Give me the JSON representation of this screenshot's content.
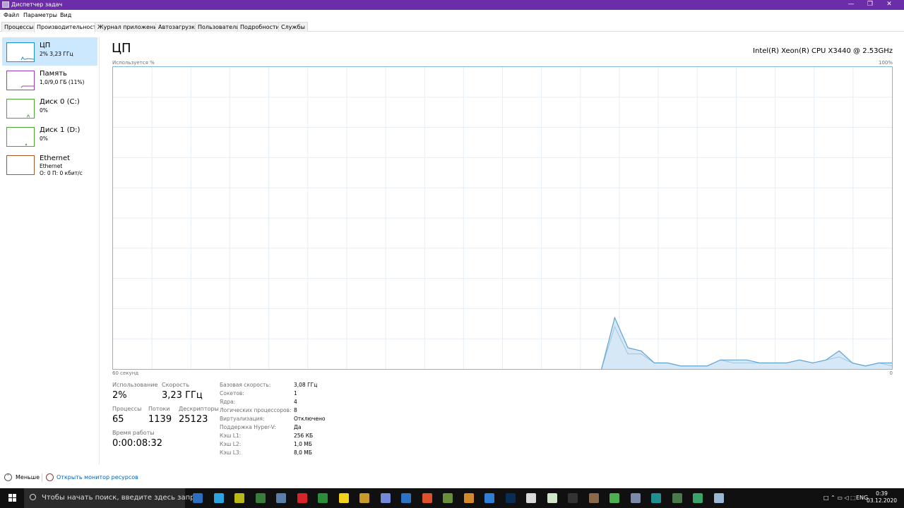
{
  "window": {
    "title": "Диспетчер задач",
    "minimize": "—",
    "maximize": "❐",
    "close": "✕"
  },
  "menu": [
    "Файл",
    "Параметры",
    "Вид"
  ],
  "tabs": [
    "Процессы",
    "Производительность",
    "Журнал приложений",
    "Автозагрузка",
    "Пользователи",
    "Подробности",
    "Службы"
  ],
  "sidebar": [
    {
      "name": "ЦП",
      "sub1": "2% 3,23 ГГц",
      "sub2": "",
      "color": "#1b8fd6"
    },
    {
      "name": "Память",
      "sub1": "1,0/9,0 ГБ (11%)",
      "sub2": "",
      "color": "#9b3ec2"
    },
    {
      "name": "Диск 0 (C:)",
      "sub1": "0%",
      "sub2": "",
      "color": "#4da632"
    },
    {
      "name": "Диск 1 (D:)",
      "sub1": "0%",
      "sub2": "",
      "color": "#4da632"
    },
    {
      "name": "Ethernet",
      "sub1": "Ethernet",
      "sub2": "О: 0 П: 0 кбит/с",
      "color": "#a7572b"
    }
  ],
  "main": {
    "title": "ЦП",
    "cpu_name": "Intel(R) Xeon(R) CPU X3440 @ 2.53GHz",
    "usage_label": "Используется %",
    "usage_max": "100%",
    "time_left": "60 секунд",
    "time_right": "0"
  },
  "stats": {
    "usage_label": "Использование",
    "usage_value": "2%",
    "speed_label": "Скорость",
    "speed_value": "3,23 ГГц",
    "processes_label": "Процессы",
    "processes_value": "65",
    "threads_label": "Потоки",
    "threads_value": "1139",
    "handles_label": "Дескрипторы",
    "handles_value": "25123",
    "uptime_label": "Время работы",
    "uptime_value": "0:00:08:32"
  },
  "details": [
    {
      "label": "Базовая скорость:",
      "value": "3,08 ГГц"
    },
    {
      "label": "Сокетов:",
      "value": "1"
    },
    {
      "label": "Ядра:",
      "value": "4"
    },
    {
      "label": "Логических процессоров:",
      "value": "8"
    },
    {
      "label": "Виртуализация:",
      "value": "Отключено"
    },
    {
      "label": "Поддержка Hyper-V:",
      "value": "Да"
    },
    {
      "label": "Кэш L1:",
      "value": "256 КБ"
    },
    {
      "label": "Кэш L2:",
      "value": "1,0 МБ"
    },
    {
      "label": "Кэш L3:",
      "value": "8,0 МБ"
    }
  ],
  "footer": {
    "fewer": "Меньше",
    "monitor": "Открыть монитор ресурсов"
  },
  "chart_data": {
    "type": "area",
    "x_range_seconds": [
      60,
      0
    ],
    "ylim": [
      0,
      100
    ],
    "samples_total": 60,
    "usage_percent": [
      17,
      7,
      6,
      2,
      2,
      1,
      1,
      1,
      3,
      3,
      3,
      2,
      2,
      2,
      3,
      2,
      3,
      6,
      2,
      1,
      2,
      2
    ],
    "kernel_percent": [
      14,
      5,
      5,
      2,
      2,
      1,
      1,
      1,
      3,
      2,
      2,
      2,
      2,
      2,
      3,
      2,
      3,
      4,
      2,
      1,
      2,
      1
    ],
    "grid": true
  },
  "taskbar": {
    "search_placeholder": "Чтобы начать поиск, введите здесь запрос",
    "lang": "ENG",
    "time": "0:39",
    "date": "03.12.2020",
    "icons": [
      {
        "name": "screenshot-tool-icon",
        "color": "#2d6fbf"
      },
      {
        "name": "telegram-icon",
        "color": "#2aa3df"
      },
      {
        "name": "yellow-app-icon",
        "color": "#b8b817"
      },
      {
        "name": "terminal-icon",
        "color": "#3a7d3a"
      },
      {
        "name": "steam-icon",
        "color": "#5a7fa8"
      },
      {
        "name": "opera-icon",
        "color": "#d8232a"
      },
      {
        "name": "xbox-icon",
        "color": "#2a8f3a"
      },
      {
        "name": "emoji-app-icon",
        "color": "#f2d21b"
      },
      {
        "name": "banana-app-icon",
        "color": "#c79a2a"
      },
      {
        "name": "discord-icon",
        "color": "#7289da"
      },
      {
        "name": "tracker-icon",
        "color": "#2c73c4"
      },
      {
        "name": "microphone-icon",
        "color": "#e0502a"
      },
      {
        "name": "minecraft-icon",
        "color": "#6a8f3a"
      },
      {
        "name": "game-app-icon",
        "color": "#d48a2a"
      },
      {
        "name": "blue-app-icon",
        "color": "#2f7fd6"
      },
      {
        "name": "photoshop-icon",
        "color": "#0a2d55"
      },
      {
        "name": "paper-app-icon",
        "color": "#d9d9d9"
      },
      {
        "name": "tshirt-app-icon",
        "color": "#cfe6c9"
      },
      {
        "name": "epic-games-icon",
        "color": "#333333"
      },
      {
        "name": "cat-app-icon",
        "color": "#8a6a4a"
      },
      {
        "name": "utorrent-icon",
        "color": "#4caf50"
      },
      {
        "name": "windows-app-icon",
        "color": "#7a8aa8"
      },
      {
        "name": "monitor-app-icon",
        "color": "#1f8f8f"
      },
      {
        "name": "console-app-icon",
        "color": "#4a7a4a"
      },
      {
        "name": "bg-app-icon",
        "color": "#3aa56a"
      },
      {
        "name": "task-manager-icon",
        "color": "#9ab7d6"
      }
    ]
  }
}
